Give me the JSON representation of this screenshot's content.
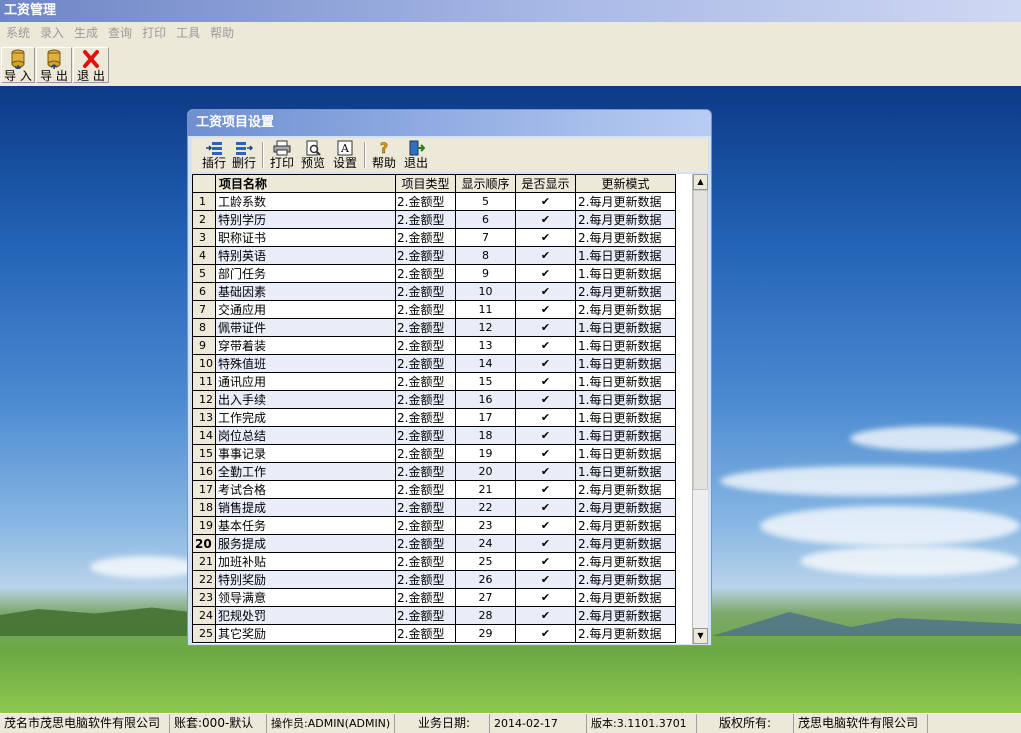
{
  "app": {
    "title": "工资管理"
  },
  "menu": [
    "系统",
    "录入",
    "生成",
    "查询",
    "打印",
    "工具",
    "帮助"
  ],
  "toolbar": {
    "import": "导 入",
    "export": "导 出",
    "exit": "退 出"
  },
  "dialog": {
    "title": "工资项目设置",
    "toolbar": {
      "insert": "插行",
      "delete": "删行",
      "print": "打印",
      "preview": "预览",
      "settings": "设置",
      "help": "帮助",
      "exit": "退出"
    },
    "columns": [
      "项目名称",
      "项目类型",
      "显示顺序",
      "是否显示",
      "更新模式"
    ],
    "current_row": 20,
    "rows": [
      {
        "no": "1",
        "name": "工龄系数",
        "type": "2.金额型",
        "order": "5",
        "show": "✔",
        "mode": "2.每月更新数据"
      },
      {
        "no": "2",
        "name": "特别学历",
        "type": "2.金额型",
        "order": "6",
        "show": "✔",
        "mode": "2.每月更新数据"
      },
      {
        "no": "3",
        "name": "职称证书",
        "type": "2.金额型",
        "order": "7",
        "show": "✔",
        "mode": "2.每月更新数据"
      },
      {
        "no": "4",
        "name": "特别英语",
        "type": "2.金额型",
        "order": "8",
        "show": "✔",
        "mode": "1.每日更新数据"
      },
      {
        "no": "5",
        "name": "部门任务",
        "type": "2.金额型",
        "order": "9",
        "show": "✔",
        "mode": "1.每日更新数据"
      },
      {
        "no": "6",
        "name": "基础因素",
        "type": "2.金额型",
        "order": "10",
        "show": "✔",
        "mode": "2.每月更新数据"
      },
      {
        "no": "7",
        "name": "交通应用",
        "type": "2.金额型",
        "order": "11",
        "show": "✔",
        "mode": "2.每月更新数据"
      },
      {
        "no": "8",
        "name": "佩带证件",
        "type": "2.金额型",
        "order": "12",
        "show": "✔",
        "mode": "1.每日更新数据"
      },
      {
        "no": "9",
        "name": "穿带着装",
        "type": "2.金额型",
        "order": "13",
        "show": "✔",
        "mode": "1.每日更新数据"
      },
      {
        "no": "10",
        "name": "特殊值班",
        "type": "2.金额型",
        "order": "14",
        "show": "✔",
        "mode": "1.每日更新数据"
      },
      {
        "no": "11",
        "name": "通讯应用",
        "type": "2.金额型",
        "order": "15",
        "show": "✔",
        "mode": "1.每日更新数据"
      },
      {
        "no": "12",
        "name": "出入手续",
        "type": "2.金额型",
        "order": "16",
        "show": "✔",
        "mode": "1.每日更新数据"
      },
      {
        "no": "13",
        "name": "工作完成",
        "type": "2.金额型",
        "order": "17",
        "show": "✔",
        "mode": "1.每日更新数据"
      },
      {
        "no": "14",
        "name": "岗位总结",
        "type": "2.金额型",
        "order": "18",
        "show": "✔",
        "mode": "1.每日更新数据"
      },
      {
        "no": "15",
        "name": "事事记录",
        "type": "2.金额型",
        "order": "19",
        "show": "✔",
        "mode": "1.每日更新数据"
      },
      {
        "no": "16",
        "name": "全勤工作",
        "type": "2.金额型",
        "order": "20",
        "show": "✔",
        "mode": "1.每日更新数据"
      },
      {
        "no": "17",
        "name": "考试合格",
        "type": "2.金额型",
        "order": "21",
        "show": "✔",
        "mode": "2.每月更新数据"
      },
      {
        "no": "18",
        "name": "销售提成",
        "type": "2.金额型",
        "order": "22",
        "show": "✔",
        "mode": "2.每月更新数据"
      },
      {
        "no": "19",
        "name": "基本任务",
        "type": "2.金额型",
        "order": "23",
        "show": "✔",
        "mode": "2.每月更新数据"
      },
      {
        "no": "20",
        "name": "服务提成",
        "type": "2.金额型",
        "order": "24",
        "show": "✔",
        "mode": "2.每月更新数据"
      },
      {
        "no": "21",
        "name": "加班补贴",
        "type": "2.金额型",
        "order": "25",
        "show": "✔",
        "mode": "2.每月更新数据"
      },
      {
        "no": "22",
        "name": "特别奖励",
        "type": "2.金额型",
        "order": "26",
        "show": "✔",
        "mode": "2.每月更新数据"
      },
      {
        "no": "23",
        "name": "领导满意",
        "type": "2.金额型",
        "order": "27",
        "show": "✔",
        "mode": "2.每月更新数据"
      },
      {
        "no": "24",
        "name": "犯规处罚",
        "type": "2.金额型",
        "order": "28",
        "show": "✔",
        "mode": "2.每月更新数据"
      },
      {
        "no": "25",
        "name": "其它奖励",
        "type": "2.金额型",
        "order": "29",
        "show": "✔",
        "mode": "2.每月更新数据"
      }
    ]
  },
  "status": {
    "company": "茂名市茂思电脑软件有限公司",
    "account": "账套:000-默认",
    "operator": "操作员:ADMIN(ADMIN)",
    "date_label": "业务日期:",
    "date": "2014-02-17",
    "version": "版本:3.1101.3701",
    "copyright_label": "版权所有:",
    "copyright": "茂思电脑软件有限公司"
  }
}
